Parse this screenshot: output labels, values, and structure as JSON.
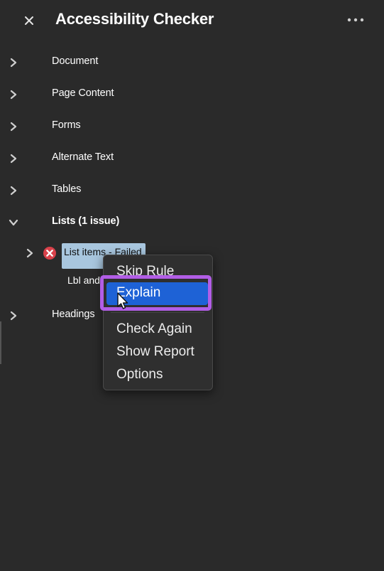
{
  "header": {
    "title": "Accessibility Checker",
    "close_icon": "close-icon",
    "more_icon": "more-options-icon"
  },
  "tree": {
    "items": [
      {
        "label": "Document",
        "expanded": false
      },
      {
        "label": "Page Content",
        "expanded": false
      },
      {
        "label": "Forms",
        "expanded": false
      },
      {
        "label": "Alternate Text",
        "expanded": false
      },
      {
        "label": "Tables",
        "expanded": false
      },
      {
        "label": "Lists (1 issue)",
        "expanded": true
      },
      {
        "label": "Headings",
        "expanded": false
      }
    ],
    "lists_children": {
      "failed_item": "List items - Failed",
      "failed_status_icon": "error-icon",
      "sub_item": "Lbl and"
    }
  },
  "context_menu": {
    "items": [
      "Skip Rule",
      "Explain",
      "Check Again",
      "Show Report",
      "Options"
    ],
    "selected": "Explain"
  },
  "colors": {
    "background": "#2a2a2a",
    "menu_background": "#2f2f2f",
    "selection_blue": "#1e62d6",
    "highlight_purple": "#b25ee6",
    "row_selection": "#a8c6de",
    "error_red": "#d9414a"
  }
}
